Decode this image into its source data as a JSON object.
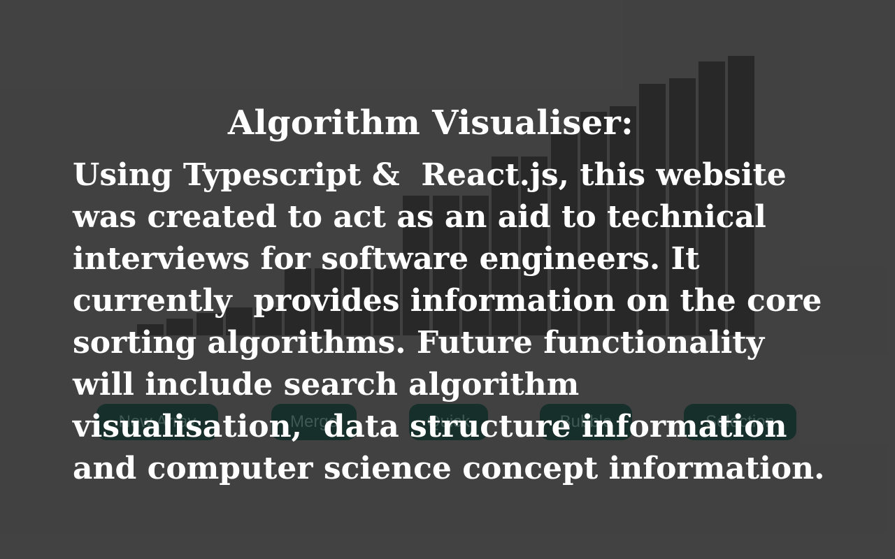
{
  "background_color": "#424242",
  "bar_color": "#222222",
  "button_color": "#0c2b24",
  "sort_bars": {
    "relative_heights": [
      0.04,
      0.06,
      0.08,
      0.1,
      0.1,
      0.24,
      0.24,
      0.24,
      0.24,
      0.5,
      0.5,
      0.5,
      0.64,
      0.64,
      0.72,
      0.8,
      0.82,
      0.9,
      0.92,
      0.98,
      1.0
    ]
  },
  "controls": {
    "new_array_label": "New Array",
    "merge_label": "Merge",
    "quick_label": "Quick",
    "bubble_label": "Bubble",
    "selection_label": "Selection"
  },
  "intro": {
    "title": "Algorithm Visualiser:",
    "description_lines": [
      "Using Typescript &  React.js, this website",
      "was created to act as an aid to technical",
      "interviews for software engineers. It",
      "currently  provides information on the core",
      "sorting algorithms. Future functionality",
      "will include search algorithm",
      "visualisation,  data structure information",
      "and computer science concept information."
    ]
  }
}
